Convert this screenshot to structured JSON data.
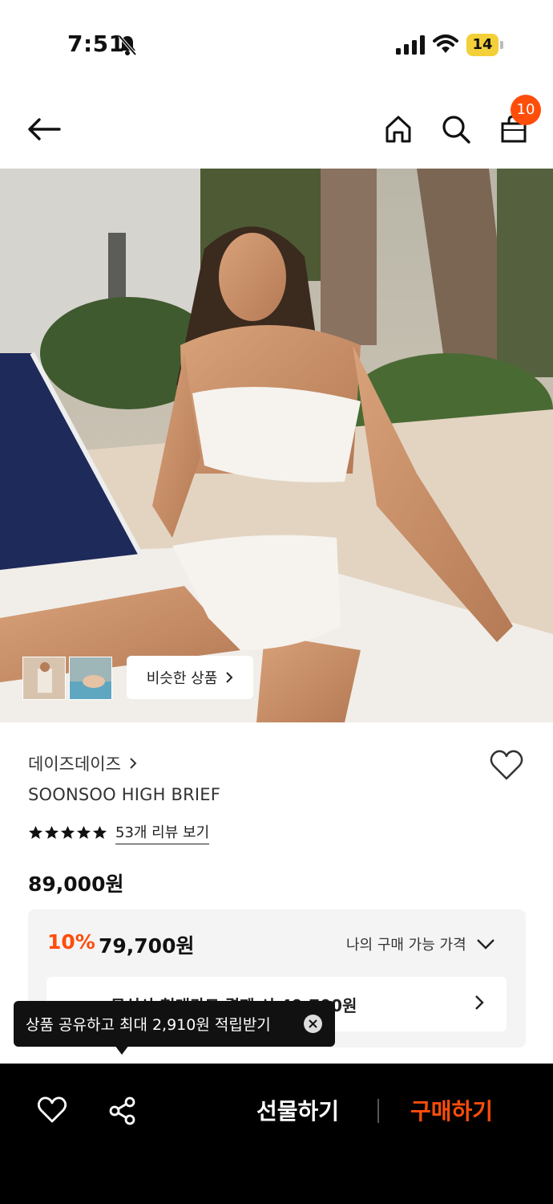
{
  "status_bar": {
    "time": "7:51",
    "battery": "14"
  },
  "nav": {
    "cart_count": "10"
  },
  "gallery": {
    "similar_label": "비슷한 상품"
  },
  "product": {
    "brand": "데이즈데이즈",
    "name": "SOONSOO HIGH BRIEF",
    "rating": 5,
    "review_link": "53개 리뷰 보기",
    "price": "89,000원"
  },
  "benefit": {
    "discount_rate": "10%",
    "discount_price": "79,700원",
    "my_price_label": "나의 구매 가능 가격",
    "card_offer": "무신사 현대카드 결제 시 49,700원"
  },
  "tooltip": {
    "text": "상품 공유하고 최대 2,910원 적립받기"
  },
  "bottom_bar": {
    "gift_label": "선물하기",
    "buy_label": "구매하기"
  },
  "colors": {
    "accent": "#ff4d0a",
    "bottom_bar": "#000000",
    "box_bg": "#f4f4f4"
  }
}
